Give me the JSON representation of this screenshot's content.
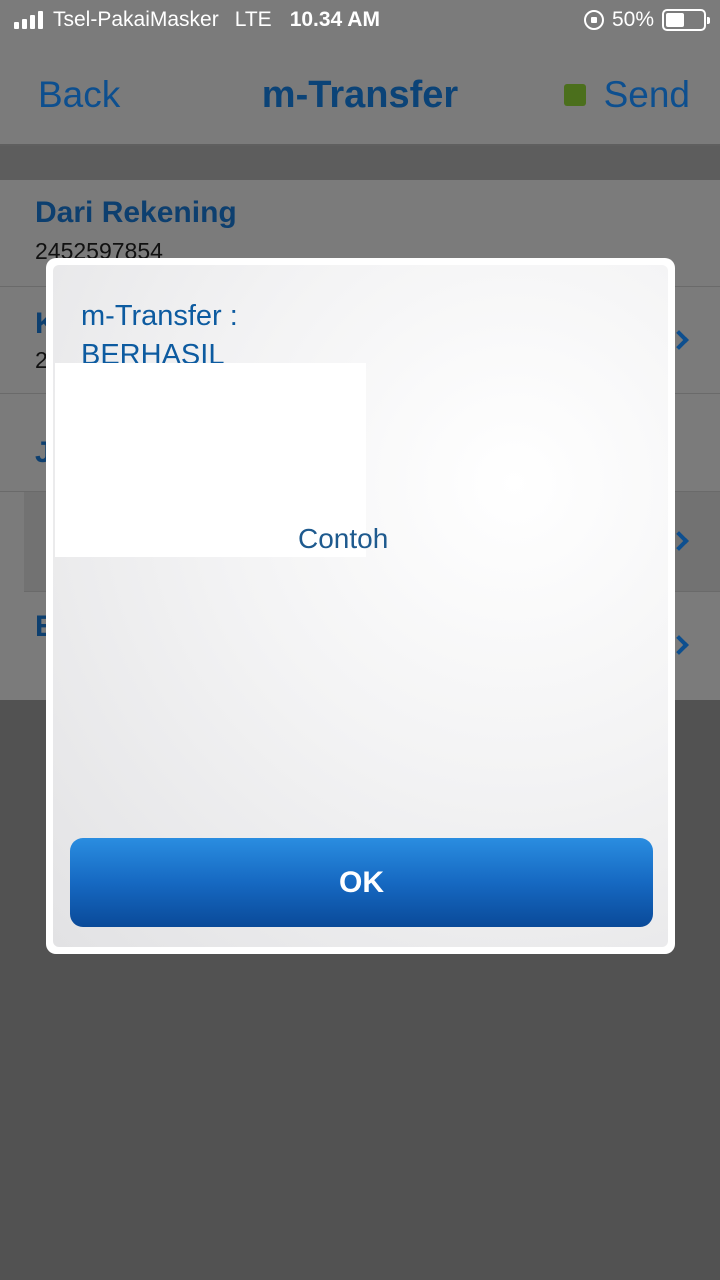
{
  "status_bar": {
    "carrier": "Tsel-PakaiMasker",
    "network": "LTE",
    "time": "10.34 AM",
    "battery_percent": "50%",
    "battery_level": 0.5
  },
  "nav": {
    "back_label": "Back",
    "title": "m-Transfer",
    "send_label": "Send",
    "send_indicator_color": "#4b6f1c"
  },
  "list": {
    "from_account_title": "Dari Rekening",
    "from_account_value": "2452597854",
    "row2_title": "K",
    "row2_value": "2",
    "row3_title": "J",
    "row5_title": "E"
  },
  "dialog": {
    "title_line1": "m-Transfer :",
    "title_line2": "BERHASIL",
    "sample_text": "Contoh",
    "ok_label": "OK"
  },
  "colors": {
    "link_blue": "#0d4f8f",
    "button_blue": "#1669c2",
    "overlay": "#525252"
  }
}
